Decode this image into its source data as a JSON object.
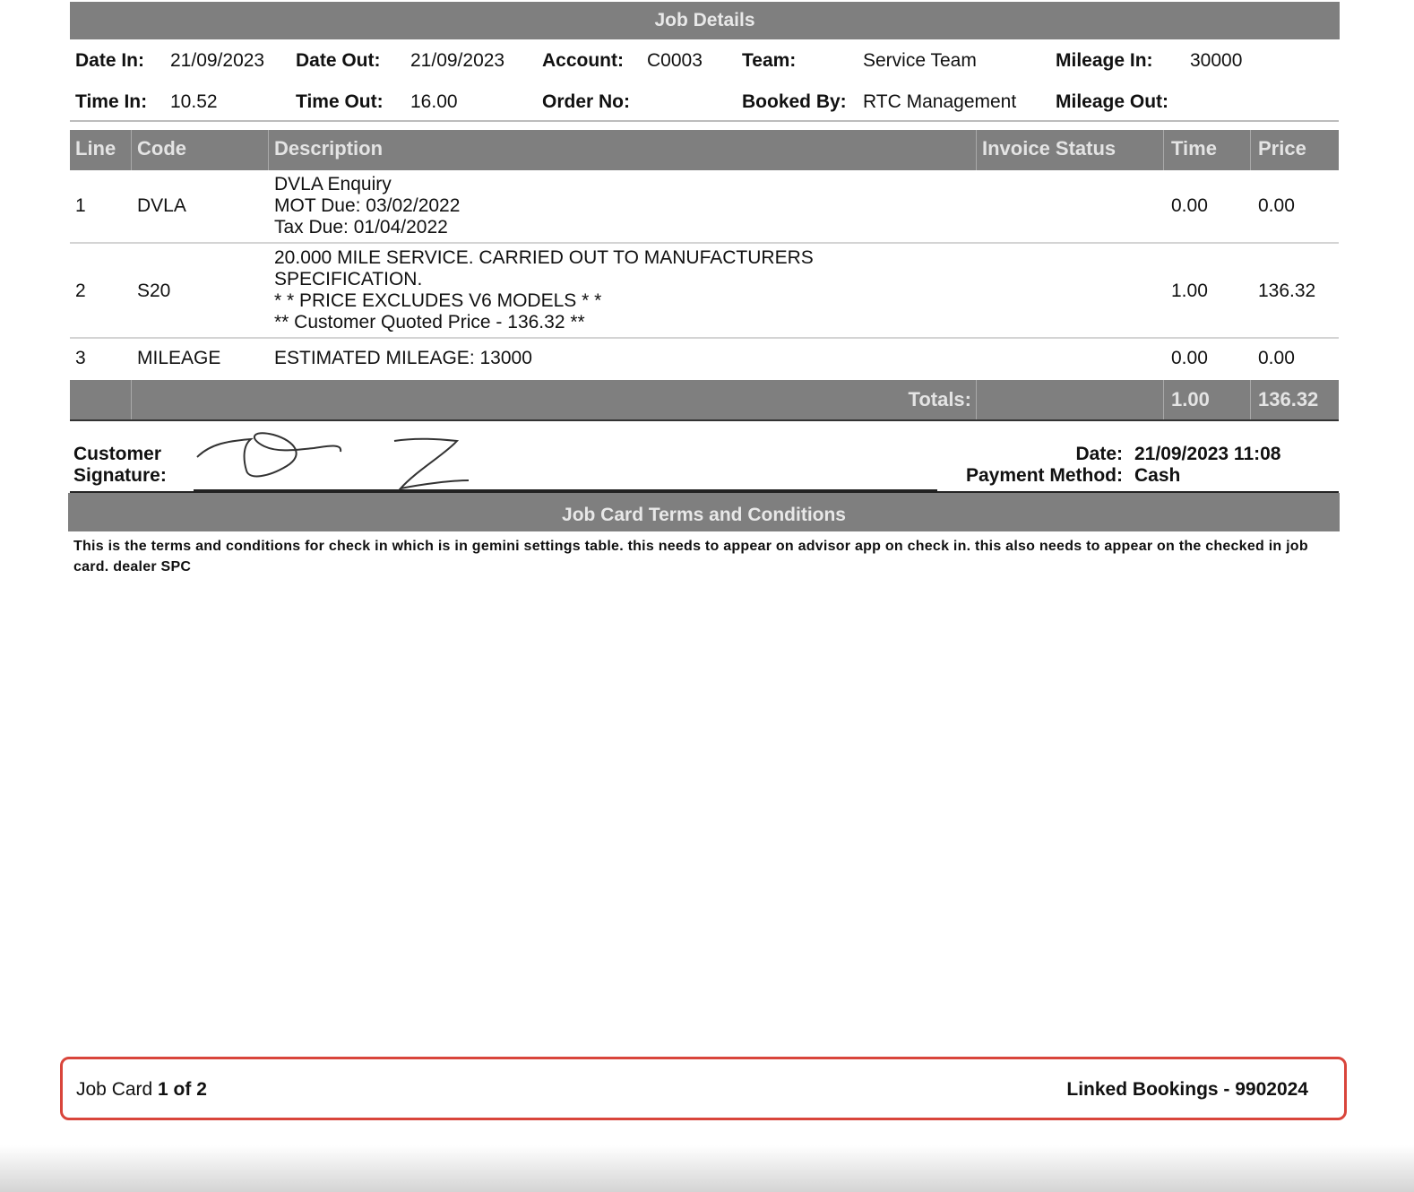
{
  "job_details": {
    "title": "Job Details",
    "date_in_label": "Date In:",
    "date_in": "21/09/2023",
    "date_out_label": "Date Out:",
    "date_out": "21/09/2023",
    "account_label": "Account:",
    "account": "C0003",
    "team_label": "Team:",
    "team": "Service Team",
    "mileage_in_label": "Mileage In:",
    "mileage_in": "30000",
    "time_in_label": "Time In:",
    "time_in": "10.52",
    "time_out_label": "Time Out:",
    "time_out": "16.00",
    "order_no_label": "Order No:",
    "order_no": "",
    "booked_by_label": "Booked By:",
    "booked_by": "RTC Management",
    "mileage_out_label": "Mileage Out:",
    "mileage_out": ""
  },
  "table": {
    "headers": {
      "line": "Line",
      "code": "Code",
      "description": "Description",
      "invoice_status": "Invoice Status",
      "time": "Time",
      "price": "Price"
    },
    "rows": [
      {
        "line": "1",
        "code": "DVLA",
        "description": [
          "DVLA Enquiry",
          "MOT Due: 03/02/2022",
          "Tax Due: 01/04/2022"
        ],
        "invoice_status": "",
        "time": "0.00",
        "price": "0.00"
      },
      {
        "line": "2",
        "code": "S20",
        "description": [
          "20.000 MILE SERVICE. CARRIED OUT TO MANUFACTURERS",
          "SPECIFICATION.",
          "* * PRICE EXCLUDES V6 MODELS * *",
          "** Customer Quoted Price - 136.32 **"
        ],
        "invoice_status": "",
        "time": "1.00",
        "price": "136.32"
      },
      {
        "line": "3",
        "code": "MILEAGE",
        "description": [
          "ESTIMATED MILEAGE: 13000"
        ],
        "invoice_status": "",
        "time": "0.00",
        "price": "0.00"
      }
    ],
    "totals": {
      "label": "Totals:",
      "time": "1.00",
      "price": "136.32"
    }
  },
  "signature": {
    "customer_label_1": "Customer",
    "customer_label_2": "Signature:",
    "date_label": "Date:",
    "date_value": "21/09/2023 11:08",
    "payment_label": "Payment Method:",
    "payment_value": "Cash"
  },
  "terms": {
    "title": "Job Card Terms and Conditions",
    "text": "This is the terms and conditions for check in which is in gemini settings table. this needs to appear on advisor app on check in. this also needs to appear on the checked in job card. dealer SPC"
  },
  "footer": {
    "job_card_prefix": "Job Card ",
    "job_card_pages": "1 of 2",
    "linked_bookings": "Linked Bookings - 9902024"
  },
  "colors": {
    "header_bar": "#7f7f7f",
    "highlight_border": "#d9453b"
  }
}
